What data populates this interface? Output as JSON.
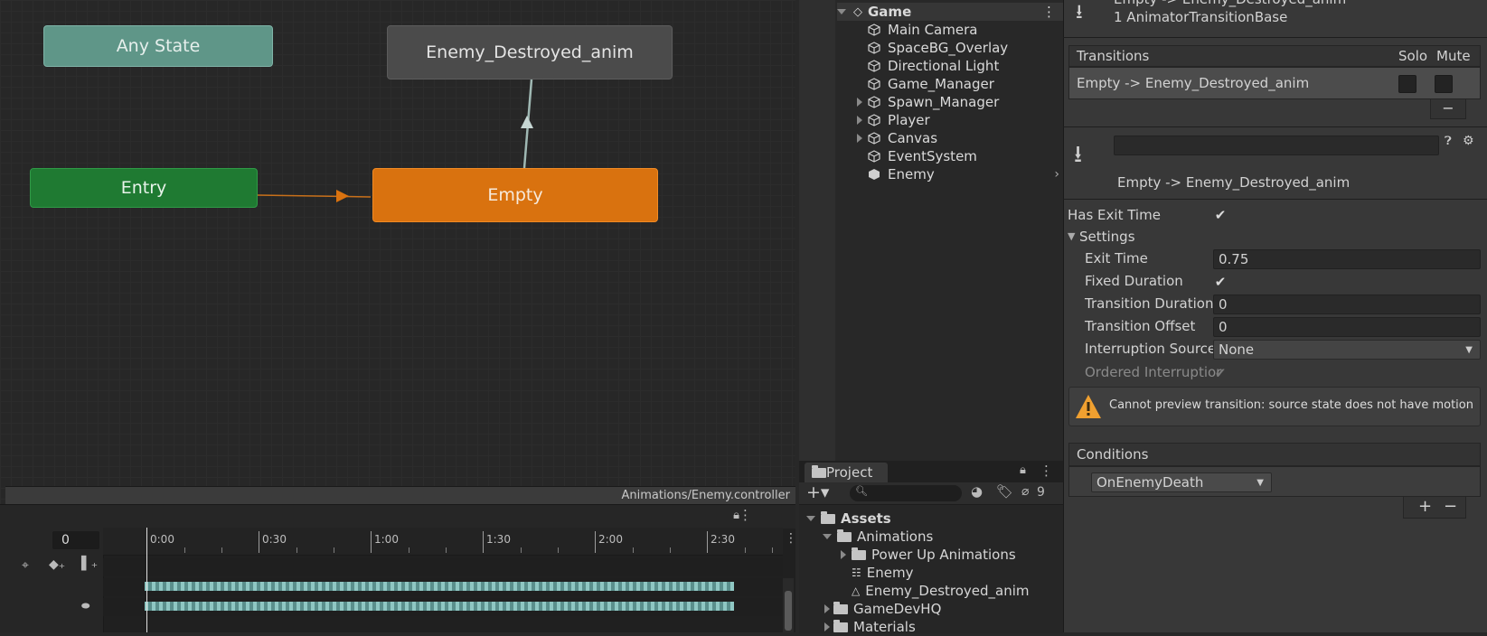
{
  "animator": {
    "nodes": {
      "any_state": "Any State",
      "destroyed": "Enemy_Destroyed_anim",
      "entry": "Entry",
      "empty": "Empty"
    },
    "footer_path": "Animations/Enemy.controller"
  },
  "timeline": {
    "frame_value": "0",
    "ticks": [
      "0:00",
      "0:30",
      "1:00",
      "1:30",
      "2:00",
      "2:30"
    ]
  },
  "hierarchy": {
    "scene": "Game",
    "items": [
      {
        "label": "Main Camera",
        "expandable": false
      },
      {
        "label": "SpaceBG_Overlay",
        "expandable": false
      },
      {
        "label": "Directional Light",
        "expandable": false
      },
      {
        "label": "Game_Manager",
        "expandable": false
      },
      {
        "label": "Spawn_Manager",
        "expandable": true
      },
      {
        "label": "Player",
        "expandable": true
      },
      {
        "label": "Canvas",
        "expandable": true
      },
      {
        "label": "EventSystem",
        "expandable": false
      },
      {
        "label": "Enemy",
        "expandable": false
      }
    ]
  },
  "project": {
    "tab": "Project",
    "hidden_count": "9",
    "tree": {
      "assets": "Assets",
      "animations": "Animations",
      "power_up": "Power Up Animations",
      "enemy": "Enemy",
      "enemy_destroyed": "Enemy_Destroyed_anim",
      "gamedevhq": "GameDevHQ",
      "materials": "Materials"
    }
  },
  "inspector": {
    "top_title": "Empty -> Enemy_Destroyed_anim",
    "top_subtitle": "1 AnimatorTransitionBase",
    "transitions_header": "Transitions",
    "solo_label": "Solo",
    "mute_label": "Mute",
    "transition_row": "Empty -> Enemy_Destroyed_anim",
    "transition_name": "Empty -> Enemy_Destroyed_anim",
    "has_exit_time_label": "Has Exit Time",
    "settings_label": "Settings",
    "exit_time_label": "Exit Time",
    "exit_time_value": "0.75",
    "fixed_duration_label": "Fixed Duration",
    "transition_duration_label": "Transition Duration",
    "transition_duration_value": "0",
    "transition_offset_label": "Transition Offset",
    "transition_offset_value": "0",
    "interruption_source_label": "Interruption Source",
    "interruption_source_value": "None",
    "ordered_interruption_label": "Ordered Interruptior",
    "warning": "Cannot preview transition: source state does not have motion",
    "conditions_header": "Conditions",
    "condition_param": "OnEnemyDeath"
  },
  "colors": {
    "entry": "#1f7a32",
    "empty": "#d9720f",
    "any_state": "#5f9688",
    "default_state": "#4a4a4a"
  }
}
